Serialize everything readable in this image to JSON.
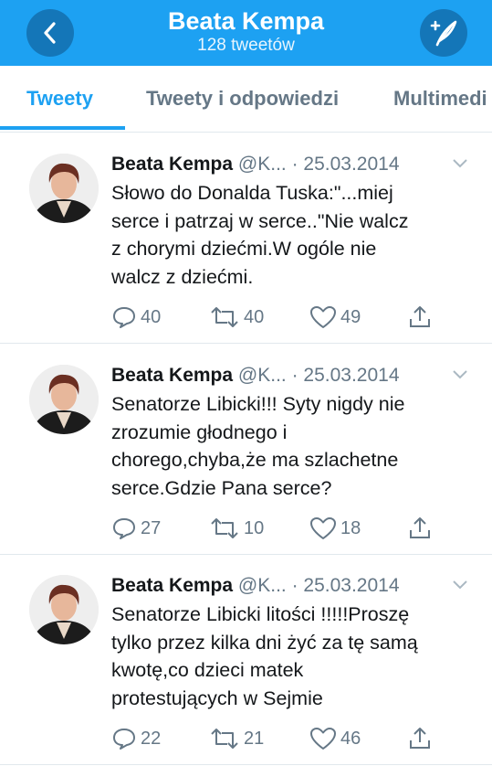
{
  "header": {
    "title": "Beata Kempa",
    "subtitle": "128 tweetów",
    "back_icon": "chevron-left-icon",
    "compose_icon": "compose-feather-icon",
    "color": "#1da1f2"
  },
  "tabs": [
    {
      "label": "Tweety",
      "active": true
    },
    {
      "label": "Tweety i odpowiedzi",
      "active": false
    },
    {
      "label": "Multimedi",
      "active": false
    }
  ],
  "tweets": [
    {
      "name": "Beata Kempa",
      "handle": "@K...",
      "date": "· 25.03.2014",
      "lines": [
        "Słowo do Donalda Tuska:\"...miej",
        "serce i patrzaj w serce..\"Nie walcz",
        "z chorymi dziećmi.W ogóle nie",
        "walcz z dziećmi."
      ],
      "replies": "40",
      "retweets": "40",
      "likes": "49"
    },
    {
      "name": "Beata Kempa",
      "handle": "@K...",
      "date": "· 25.03.2014",
      "lines": [
        "Senatorze Libicki!!! Syty nigdy nie",
        "zrozumie głodnego i",
        "chorego,chyba,że ma szlachetne",
        "serce.Gdzie Pana serce?"
      ],
      "replies": "27",
      "retweets": "10",
      "likes": "18"
    },
    {
      "name": "Beata Kempa",
      "handle": "@K...",
      "date": "· 25.03.2014",
      "lines": [
        "Senatorze Libicki litości !!!!!Proszę",
        "tylko przez kilka dni żyć za tę samą",
        "kwotę,co dzieci matek",
        "protestujących w Sejmie"
      ],
      "replies": "22",
      "retweets": "21",
      "likes": "46"
    }
  ]
}
